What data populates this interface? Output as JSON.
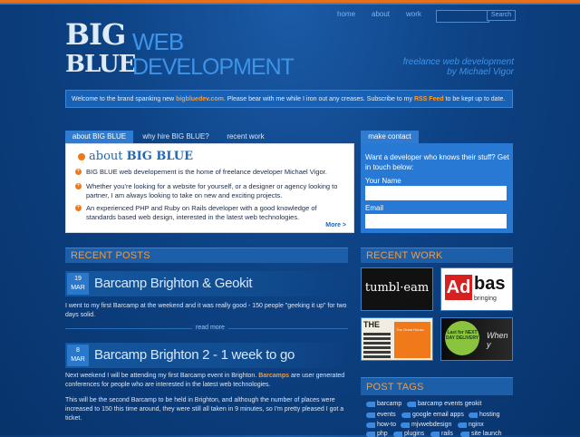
{
  "nav": {
    "home": "home",
    "about": "about",
    "work": "work",
    "search_button": "Search",
    "search_placeholder": ""
  },
  "logo": {
    "big": "BIG",
    "blue": "BLUE",
    "web": "WEB",
    "development": "DEVELOPMENT"
  },
  "tagline": {
    "line1": "freelance web development",
    "line2": "by Michael Vigor"
  },
  "welcome": {
    "before": "Welcome to the brand spanking new ",
    "site": "bigbluedev.com",
    "middle": ". Please bear with me while I iron out any creases. Subscribe to my ",
    "rss": "RSS Feed",
    "after": " to be kept up to date."
  },
  "tabs": [
    {
      "label": "about BIG BLUE",
      "active": true
    },
    {
      "label": "why hire BIG BLUE?",
      "active": false
    },
    {
      "label": "recent work",
      "active": false
    }
  ],
  "about": {
    "title_prefix": "about",
    "title_brand": "BIG BLUE",
    "bullets": [
      "BIG BLUE web developement is the home of freelance developer Michael Vigor.",
      "Whether you're looking for a website for yourself, or a designer or agency looking to partner, I am always looking to take on new and exciting projects.",
      "An experienced PHP and Ruby on Rails developer with a good knowledge of standards based web design, interested in the latest web technologies."
    ],
    "more": "More >"
  },
  "contact": {
    "tab": "make contact",
    "intro": "Want a developer who knows their stuff? Get in touch below:",
    "name_label": "Your Name",
    "email_label": "Email"
  },
  "recent_posts": {
    "heading": "RECENT POSTS",
    "posts": [
      {
        "day": "19",
        "month": "MAR",
        "title": "Barcamp Brighton & Geokit",
        "body": "I went to my first Barcamp at the weekend and it was really good - 150 people \"geeking it up\" for two days solid.",
        "readmore": "read more"
      },
      {
        "day": "8",
        "month": "MAR",
        "title": "Barcamp Brighton 2 - 1 week to go",
        "body_before": "Next weekend I will be attending my first Barcamp event in Brighton. ",
        "body_link": "Barcamps",
        "body_after": " are user generated conferences for people who are interested in the latest web technologies.",
        "body2": "This will be the second Barcamp to be held in Brighton, and although the number of places were increased to 150 this time around, they were still all taken in 9 minutes, so I'm pretty pleased I got a ticket."
      }
    ]
  },
  "recent_work": {
    "heading": "RECENT WORK",
    "items": [
      {
        "label": "tumbl·eam"
      },
      {
        "label": "Ad",
        "label2": "bas",
        "label3": "bringing"
      },
      {
        "label": "THE",
        "label2": "The Great House"
      },
      {
        "label": "Last for NEXT DAY DELIVERY",
        "label2": "When y"
      }
    ]
  },
  "post_tags": {
    "heading": "POST TAGS",
    "tags": [
      "barcamp",
      "barcamp events geokit",
      "events",
      "google email apps",
      "hosting",
      "how-to",
      "mjvwebdesign",
      "nginx",
      "php",
      "plugins",
      "rails",
      "site launch"
    ]
  },
  "colors": {
    "accent": "#f29b3b",
    "primary": "#2f7bd0",
    "background": "#0d4284"
  }
}
